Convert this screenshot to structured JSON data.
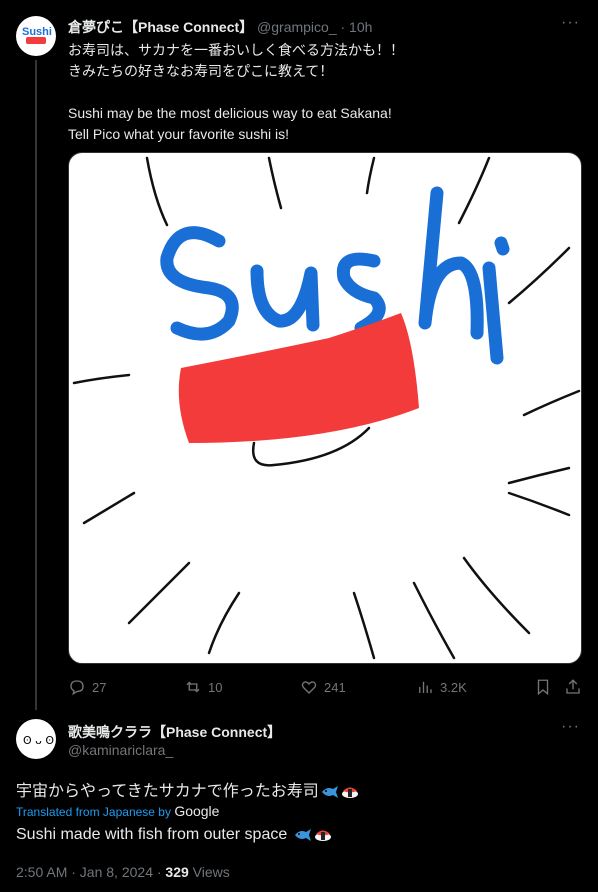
{
  "post1": {
    "display_name": "倉夢ぴこ【Phase Connect】",
    "handle": "@grampico_",
    "time": "· 10h",
    "more": "···",
    "text_lines": [
      "お寿司は、サカナを一番おいしく食べる方法かも！！",
      "きみたちの好きなお寿司をぴこに教えて！",
      "Sushi may be the most delicious way to eat Sakana!",
      "Tell Pico what your favorite sushi is!"
    ],
    "image_text": "Sushi",
    "actions": {
      "replies": "27",
      "reposts": "10",
      "likes": "241",
      "views": "3.2K"
    }
  },
  "post2": {
    "display_name": "歌美鳴クララ【Phase Connect】",
    "handle": "@kaminariclara_",
    "more": "···",
    "text_jp": "宇宙からやってきたサカナで作ったお寿司",
    "translated_prefix": "Translated from Japanese by",
    "translator": "Google",
    "text_en": "Sushi made with fish from outer space",
    "timestamp": "2:50 AM · Jan 8, 2024 · ",
    "view_count": "329",
    "views_label": " Views"
  },
  "colors": {
    "background": "#000000",
    "text": "#e7e9ea",
    "muted": "#71767b",
    "link": "#1d9bf0",
    "sushi_blue": "#1a6fd6",
    "sushi_red": "#f43b3b"
  }
}
